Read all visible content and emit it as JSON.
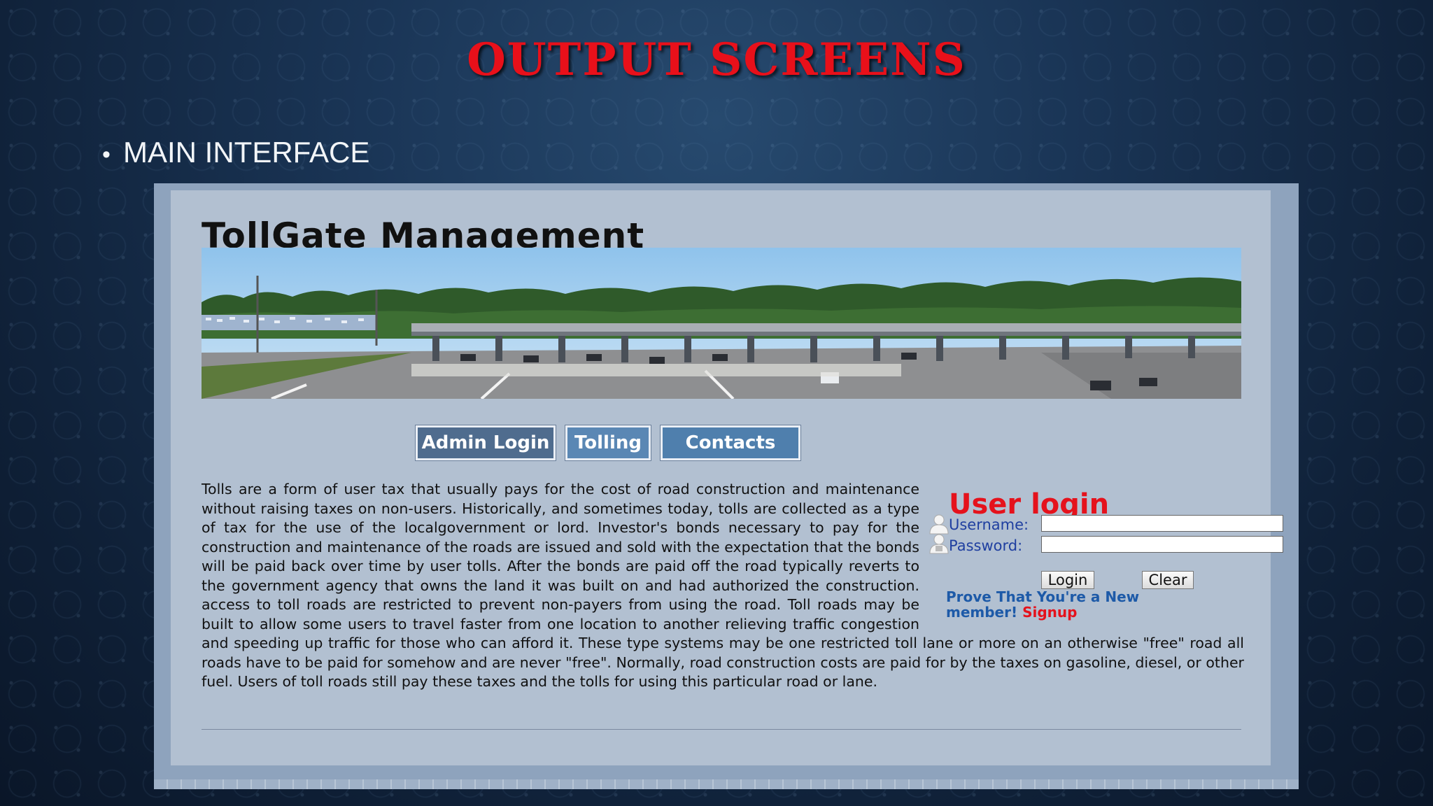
{
  "slide": {
    "title": "OUTPUT SCREENS",
    "bullet": "MAIN INTERFACE"
  },
  "site": {
    "title": "TollGate Management",
    "nav": [
      {
        "label": "Admin Login",
        "color": "#4f6c8e"
      },
      {
        "label": "Tolling",
        "color": "#5a87b4"
      },
      {
        "label": "Contacts",
        "color": "#4f7fad"
      }
    ],
    "description": "Tolls are a form of user tax that usually pays for the cost of road construction and maintenance without raising taxes on non-users. Historically, and sometimes today, tolls are collected as a type of tax for the use of the localgovernment or lord. Investor's bonds necessary to pay for the construction and maintenance of the roads are issued and sold with the expectation that the bonds will be paid back over time by user tolls. After the bonds are paid off the road typically reverts to the government agency that owns the land it was built on and had authorized the construction. access to toll roads are restricted to prevent non-payers from using the road. Toll roads may be built to allow some users to travel faster from one location to another relieving traffic congestion and speeding up traffic for those who can afford it. These type systems may be one restricted toll lane or more on an otherwise \"free\" road all roads have to be paid for somehow and are never \"free\". Normally, road construction costs are paid for by the taxes on gasoline, diesel, or other fuel. Users of toll roads still pay these taxes and the tolls for using this particular road or lane."
  },
  "login": {
    "title": "User login",
    "username_label": "Username:",
    "password_label": "Password:",
    "username_value": "",
    "password_value": "",
    "login_button": "Login",
    "clear_button": "Clear",
    "promo_text": "Prove That You're a New member!",
    "signup_link": "Signup"
  },
  "colors": {
    "slide_title": "#e8101a",
    "login_title": "#e5121c",
    "label_blue": "#1f3fa0",
    "promo_blue": "#1d5aa8"
  }
}
